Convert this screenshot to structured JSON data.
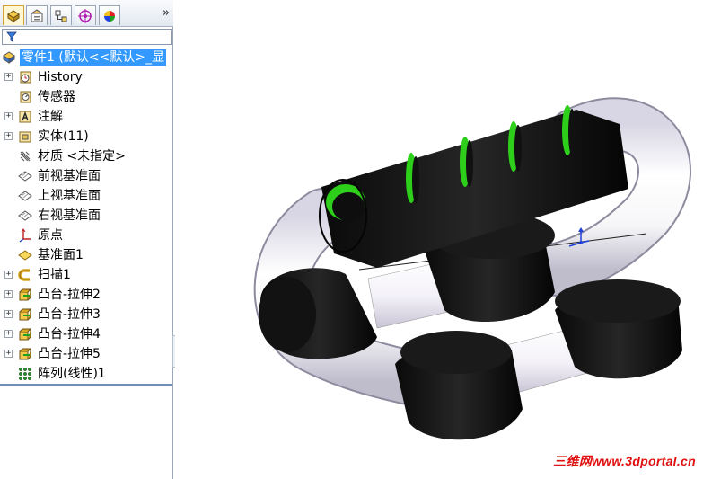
{
  "colors": {
    "selection": "#3399ff",
    "handle_black": "#1a1a1a",
    "ring_green": "#2ecf1a",
    "tube_white": "#f4f4f6",
    "watermark_red": "#e01010",
    "triad_blue": "#1f3fd9"
  },
  "tabs": [
    {
      "name": "feature-manager-tab",
      "icon": "feature-tree-icon",
      "active": true
    },
    {
      "name": "property-manager-tab",
      "icon": "property-icon",
      "active": false
    },
    {
      "name": "configuration-manager-tab",
      "icon": "configuration-icon",
      "active": false
    },
    {
      "name": "dimxpert-tab",
      "icon": "target-icon",
      "active": false
    },
    {
      "name": "display-manager-tab",
      "icon": "color-wheel-icon",
      "active": false
    }
  ],
  "tab_more": "»",
  "tree": {
    "root": "零件1  (默认<<默认>_显",
    "items": [
      {
        "label": "History",
        "icon": "history-icon",
        "expander": "+"
      },
      {
        "label": "传感器",
        "icon": "sensor-icon",
        "expander": ""
      },
      {
        "label": "注解",
        "icon": "annotation-icon",
        "expander": "+"
      },
      {
        "label": "实体(11)",
        "icon": "solid-bodies-icon",
        "expander": "+"
      },
      {
        "label": "材质 <未指定>",
        "icon": "material-icon",
        "expander": ""
      },
      {
        "label": "前视基准面",
        "icon": "plane-icon",
        "expander": ""
      },
      {
        "label": "上视基准面",
        "icon": "plane-icon",
        "expander": ""
      },
      {
        "label": "右视基准面",
        "icon": "plane-icon",
        "expander": ""
      },
      {
        "label": "原点",
        "icon": "origin-icon",
        "expander": ""
      },
      {
        "label": "基准面1",
        "icon": "plane-yellow-icon",
        "expander": ""
      },
      {
        "label": "扫描1",
        "icon": "sweep-icon",
        "expander": "+"
      },
      {
        "label": "凸台-拉伸2",
        "icon": "extrude-icon",
        "expander": "+"
      },
      {
        "label": "凸台-拉伸3",
        "icon": "extrude-icon",
        "expander": "+"
      },
      {
        "label": "凸台-拉伸4",
        "icon": "extrude-icon",
        "expander": "+"
      },
      {
        "label": "凸台-拉伸5",
        "icon": "extrude-icon",
        "expander": "+"
      },
      {
        "label": "阵列(线性)1",
        "icon": "linear-pattern-icon",
        "expander": ""
      }
    ]
  },
  "watermark": "三维网www.3dportal.cn"
}
